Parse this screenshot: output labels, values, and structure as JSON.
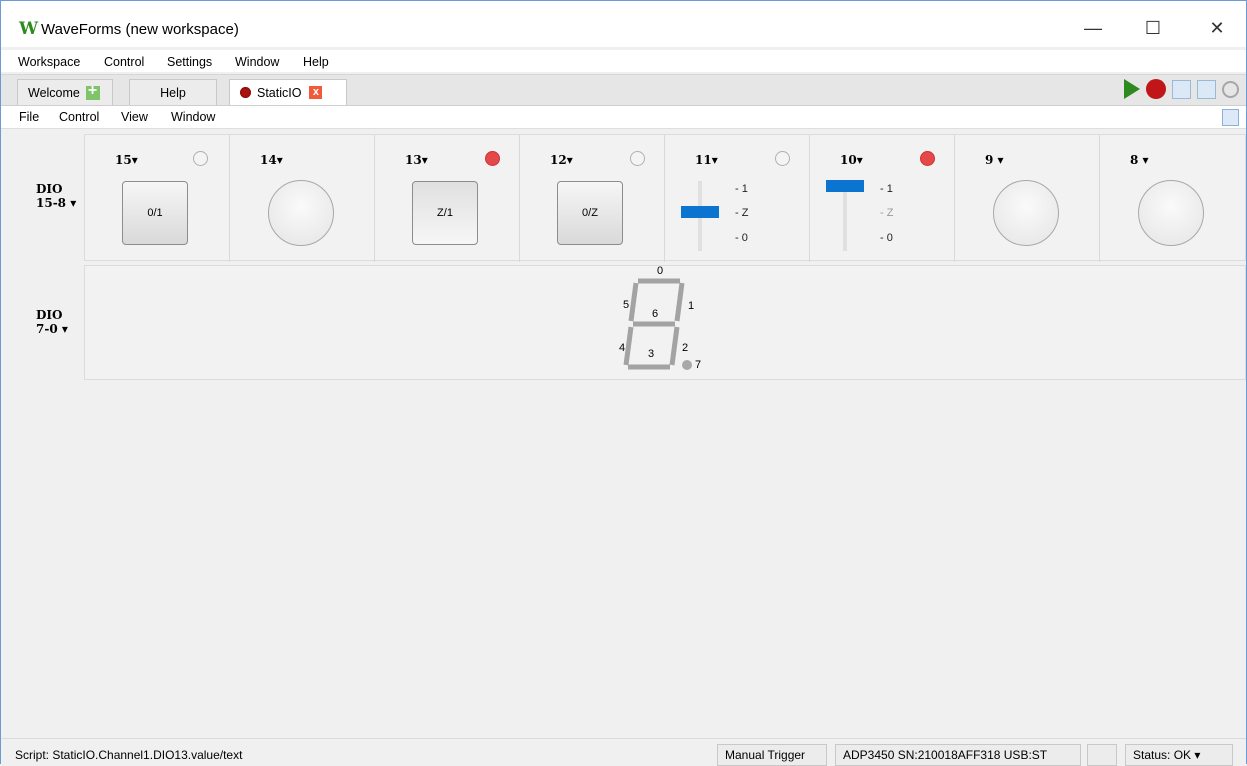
{
  "window": {
    "logo_letter": "W",
    "title": "WaveForms (new workspace)",
    "minimize": "—",
    "maximize": "☐",
    "close": "✕"
  },
  "menu": [
    "Workspace",
    "Control",
    "Settings",
    "Window",
    "Help"
  ],
  "tabs": [
    {
      "label": "Welcome"
    },
    {
      "label": "Help"
    },
    {
      "label": "StaticIO",
      "close": "x"
    }
  ],
  "submenu": [
    "File",
    "Control",
    "View",
    "Window"
  ],
  "rows": {
    "top_label": "DIO",
    "top_range": "15-8",
    "bottom_label": "DIO",
    "bottom_range": "7-0",
    "caret": "▾"
  },
  "channels": [
    {
      "pin": "15",
      "led": "off",
      "control": "button",
      "label": "0/1"
    },
    {
      "pin": "14",
      "led": "none",
      "control": "circle"
    },
    {
      "pin": "13",
      "led": "on",
      "control": "button",
      "label": "Z/1",
      "pressed": true
    },
    {
      "pin": "12",
      "led": "off",
      "control": "button",
      "label": "0/Z"
    },
    {
      "pin": "11",
      "led": "off",
      "control": "slider",
      "value": "Z",
      "options": [
        "1",
        "Z",
        "0"
      ]
    },
    {
      "pin": "10",
      "led": "on",
      "control": "slider",
      "value": "1",
      "options": [
        "1",
        "Z",
        "0"
      ]
    },
    {
      "pin": "9",
      "led": "none",
      "control": "circle"
    },
    {
      "pin": "8",
      "led": "none",
      "control": "circle"
    }
  ],
  "seven_segment": {
    "labels": [
      "0",
      "1",
      "2",
      "3",
      "4",
      "5",
      "6",
      "7"
    ]
  },
  "statusbar": {
    "script": "Script: StaticIO.Channel1.DIO13.value/text",
    "manual_trigger": "Manual Trigger",
    "device": "ADP3450 SN:210018AFF318 USB:ST",
    "status": "Status: OK"
  }
}
